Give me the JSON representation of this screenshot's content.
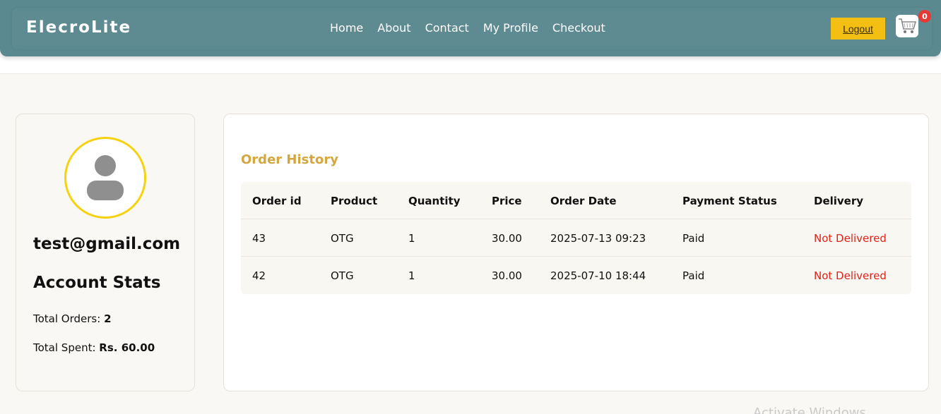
{
  "header": {
    "brand": "ElecroLite",
    "nav": [
      "Home",
      "About",
      "Contact",
      "My Profile",
      "Checkout"
    ],
    "logout_label": "Logout",
    "cart_count": "0",
    "colors": {
      "header_bg": "#5a8a8f",
      "logout_bg": "#f3bf12",
      "badge_bg": "#e53935"
    }
  },
  "profile": {
    "email": "test@gmail.com",
    "stats_title": "Account Stats",
    "total_orders_label": "Total Orders:",
    "total_orders_value": "2",
    "total_spent_label": "Total Spent:",
    "total_spent_value": "Rs. 60.00",
    "avatar_icon": "user-silhouette-icon",
    "avatar_ring_color": "#f5d20f"
  },
  "orders": {
    "title": "Order History",
    "columns": [
      "Order id",
      "Product",
      "Quantity",
      "Price",
      "Order Date",
      "Payment Status",
      "Delivery"
    ],
    "rows": [
      [
        "43",
        "OTG",
        "1",
        "30.00",
        "2025-07-13 09:23",
        "Paid",
        "Not Delivered"
      ],
      [
        "42",
        "OTG",
        "1",
        "30.00",
        "2025-07-10 18:44",
        "Paid",
        "Not Delivered"
      ]
    ],
    "title_color": "#d4a73e",
    "not_delivered_color": "#e0221a"
  },
  "watermark": "Activate Windows"
}
